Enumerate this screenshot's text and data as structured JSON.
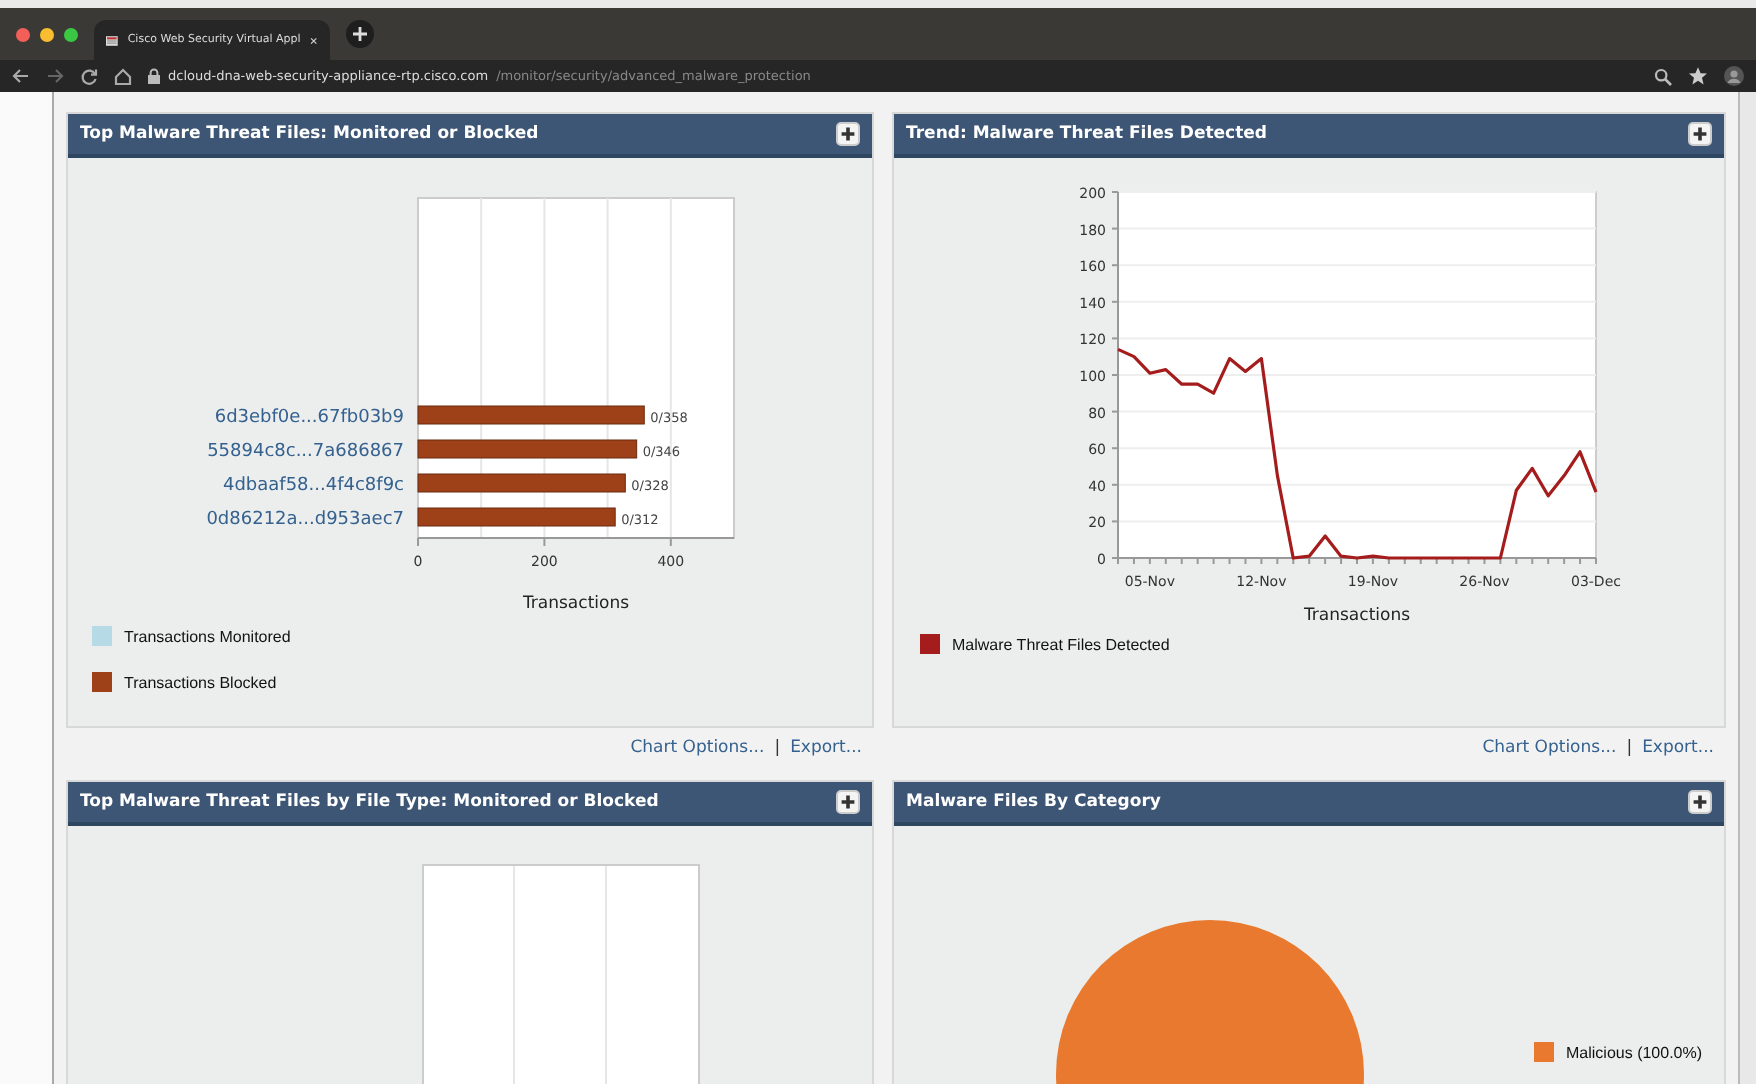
{
  "browser": {
    "tab_title": "Cisco Web Security Virtual Appl",
    "url_host": "dcloud-dna-web-security-appliance-rtp.cisco.com",
    "url_path": "/monitor/security/advanced_malware_protection"
  },
  "panels": [
    {
      "title": "Top Malware Threat Files: Monitored or Blocked",
      "chart_data": {
        "type": "bar",
        "orientation": "horizontal",
        "xlabel": "Transactions",
        "categories": [
          "6d3ebf0e...67fb03b9",
          "55894c8c...7a686867",
          "4dbaaf58...4f4c8f9c",
          "0d86212a...d953aec7"
        ],
        "series": [
          {
            "name": "Transactions Monitored",
            "color": "#b7dbe6",
            "values": [
              0,
              0,
              0,
              0
            ]
          },
          {
            "name": "Transactions Blocked",
            "color": "#9e4118",
            "values": [
              358,
              346,
              328,
              312
            ]
          }
        ],
        "xlim": [
          0,
          500
        ],
        "xticks": [
          0,
          200,
          400
        ],
        "value_labels": [
          "0/358",
          "0/346",
          "0/328",
          "0/312"
        ]
      },
      "links": [
        "Chart Options...",
        "Export..."
      ],
      "link_separator": "|"
    },
    {
      "title": "Trend: Malware Threat Files Detected",
      "chart_data": {
        "type": "line",
        "xlabel": "Transactions",
        "categories": [
          null,
          null,
          "05-Nov",
          null,
          null,
          null,
          null,
          null,
          null,
          "12-Nov",
          null,
          null,
          null,
          null,
          null,
          null,
          "19-Nov",
          null,
          null,
          null,
          null,
          null,
          null,
          "26-Nov",
          null,
          null,
          null,
          null,
          null,
          null,
          "03-Dec"
        ],
        "series": [
          {
            "name": "Malware Threat Files Detected",
            "color": "#a51c1c",
            "values": [
              114,
              110,
              101,
              103,
              95,
              95,
              90,
              109,
              102,
              109,
              45,
              0,
              1,
              12,
              1,
              0,
              1,
              0,
              0,
              0,
              0,
              0,
              0,
              0,
              0,
              37,
              49,
              34,
              45,
              58,
              36
            ]
          }
        ],
        "ylim": [
          0,
          200
        ],
        "grid": true,
        "yticks": [
          0,
          20,
          40,
          60,
          80,
          100,
          120,
          140,
          160,
          180,
          200
        ]
      },
      "links": [
        "Chart Options...",
        "Export..."
      ],
      "link_separator": "|"
    },
    {
      "kind": "empty",
      "title": "Top Malware Threat Files by File Type: Monitored or Blocked"
    },
    {
      "kind": "pie",
      "title": "Malware Files By Category",
      "legend": [
        {
          "label": "Malicious (100.0%)",
          "color": "#e8792f"
        }
      ]
    }
  ]
}
